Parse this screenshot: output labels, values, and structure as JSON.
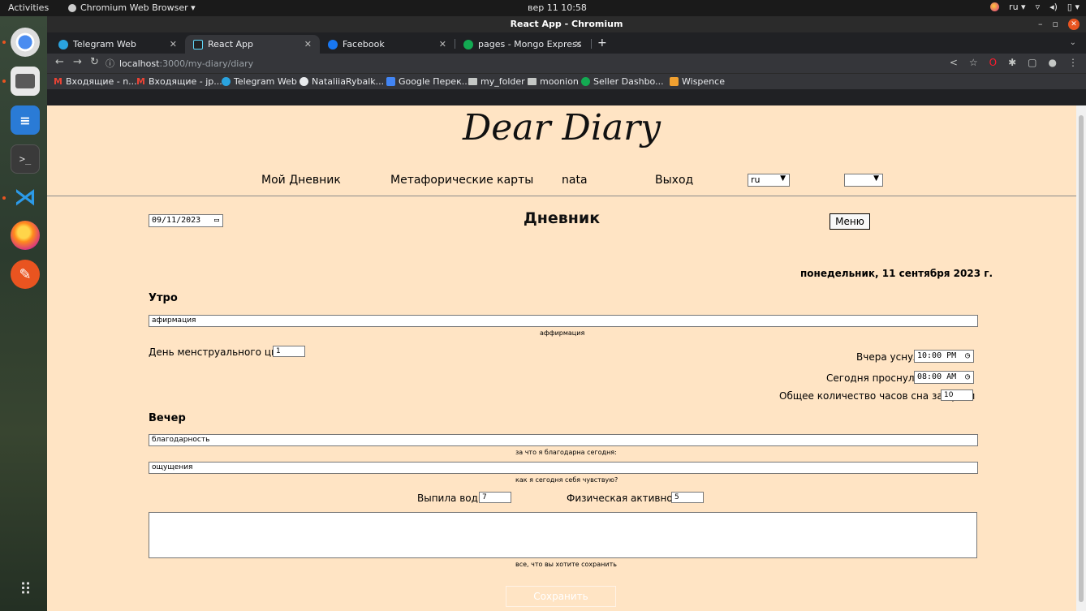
{
  "topbar": {
    "activities": "Activities",
    "app": "Chromium Web Browser ▾",
    "clock": "вер 11  10:58",
    "lang": "ru ▾"
  },
  "window": {
    "title": "React App - Chromium"
  },
  "tabs": [
    {
      "label": "Telegram Web",
      "icon": "telegram-icon"
    },
    {
      "label": "React App",
      "icon": "react-icon"
    },
    {
      "label": "Facebook",
      "icon": "facebook-icon"
    },
    {
      "label": "pages - Mongo Express",
      "icon": "mongo-icon"
    }
  ],
  "address": {
    "host": "localhost",
    "path": ":3000/my-diary/diary"
  },
  "bookmarks": [
    {
      "label": "Входящие - n...",
      "icon": "gmail-icon"
    },
    {
      "label": "Входящие - jp...",
      "icon": "gmail-icon"
    },
    {
      "label": "Telegram Web",
      "icon": "telegram-icon"
    },
    {
      "label": "NataliiaRybalk...",
      "icon": "github-icon"
    },
    {
      "label": "Google Перек...",
      "icon": "google-translate-icon"
    },
    {
      "label": "my_folder",
      "icon": "folder-icon"
    },
    {
      "label": "moonion",
      "icon": "folder-icon"
    },
    {
      "label": "Seller Dashbo...",
      "icon": "seller-icon"
    },
    {
      "label": "Wispence",
      "icon": "wispence-icon"
    }
  ],
  "site": {
    "logo": "Dear Diary",
    "nav": {
      "diary": "Мой Дневник",
      "cards": "Метафорические карты",
      "user": "nata",
      "logout": "Выход"
    },
    "lang_select": "ru",
    "second_select": ""
  },
  "diary": {
    "date_input": "09/11/2023",
    "title": "Дневник",
    "menu_button": "Меню",
    "full_date": "понедельник, 11 сентября 2023 г.",
    "morning": {
      "heading": "Утро",
      "affirmation_value": "афирмация",
      "affirmation_hint": "аффирмация",
      "cycle_label": "День менструального цикла",
      "cycle_value": "1",
      "slept_label": "Вчера уснула",
      "slept_value": "10:00 PM",
      "woke_label": "Сегодня проснулась",
      "woke_value": "08:00 AM",
      "hours_label": "Общее количество часов сна за сутки",
      "hours_value": "10"
    },
    "evening": {
      "heading": "Вечер",
      "gratitude_value": "благодарность",
      "gratitude_hint": "за что я благодарна сегодня:",
      "feelings_value": "ощущения",
      "feelings_hint": "как я сегодня себя чувствую?",
      "water_label": "Выпила воды",
      "water_value": "7",
      "activity_label": "Физическая активность",
      "activity_value": "5",
      "notes_value": "",
      "notes_hint": "все, что вы хотите сохранить"
    },
    "save_button": "Сохранить"
  }
}
